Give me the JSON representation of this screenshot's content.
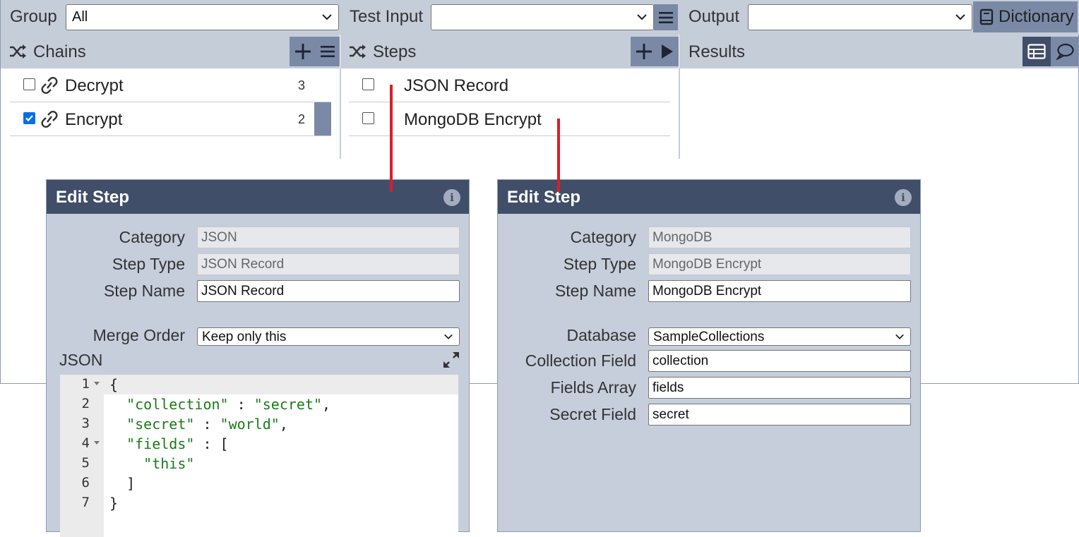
{
  "toolbar": {
    "group_label": "Group",
    "group_value": "All",
    "test_input_label": "Test Input",
    "test_input_value": "",
    "output_label": "Output",
    "output_value": "",
    "dictionary_label": "Dictionary"
  },
  "chains": {
    "title": "Chains",
    "items": [
      {
        "label": "Decrypt",
        "count": "3",
        "checked": false
      },
      {
        "label": "Encrypt",
        "count": "2",
        "checked": true
      }
    ]
  },
  "steps": {
    "title": "Steps",
    "items": [
      {
        "label": "JSON Record",
        "checked": false
      },
      {
        "label": "MongoDB Encrypt",
        "checked": false
      }
    ]
  },
  "results": {
    "title": "Results"
  },
  "edit_json": {
    "title": "Edit Step",
    "info_glyph": "i",
    "category_label": "Category",
    "category_value": "JSON",
    "step_type_label": "Step Type",
    "step_type_value": "JSON Record",
    "step_name_label": "Step Name",
    "step_name_value": "JSON Record",
    "merge_order_label": "Merge Order",
    "merge_order_value": "Keep only this",
    "json_label": "JSON",
    "code_lines": [
      {
        "n": "1",
        "fold": true
      },
      {
        "n": "2",
        "fold": false
      },
      {
        "n": "3",
        "fold": false
      },
      {
        "n": "4",
        "fold": true
      },
      {
        "n": "5",
        "fold": false
      },
      {
        "n": "6",
        "fold": false
      },
      {
        "n": "7",
        "fold": false
      }
    ],
    "code": {
      "l1": "{",
      "l2_key": "\"collection\"",
      "l2_sep": " : ",
      "l2_val": "\"secret\"",
      "l2_end": ",",
      "l3_key": "\"secret\"",
      "l3_sep": " : ",
      "l3_val": "\"world\"",
      "l3_end": ",",
      "l4_key": "\"fields\"",
      "l4_sep": " : [",
      "l5_val": "\"this\"",
      "l6": "]",
      "l7": "}"
    }
  },
  "edit_mongo": {
    "title": "Edit Step",
    "info_glyph": "i",
    "category_label": "Category",
    "category_value": "MongoDB",
    "step_type_label": "Step Type",
    "step_type_value": "MongoDB Encrypt",
    "step_name_label": "Step Name",
    "step_name_value": "MongoDB Encrypt",
    "database_label": "Database",
    "database_value": "SampleCollections",
    "collection_field_label": "Collection Field",
    "collection_field_value": "collection",
    "fields_array_label": "Fields Array",
    "fields_array_value": "fields",
    "secret_field_label": "Secret Field",
    "secret_field_value": "secret"
  },
  "colors": {
    "toolbar_bg": "#c5cdd9",
    "button_bg": "#7a8aa6",
    "panel_header": "#414e69",
    "checkbox_checked": "#0b6ee6",
    "connector": "#d61f2c"
  }
}
